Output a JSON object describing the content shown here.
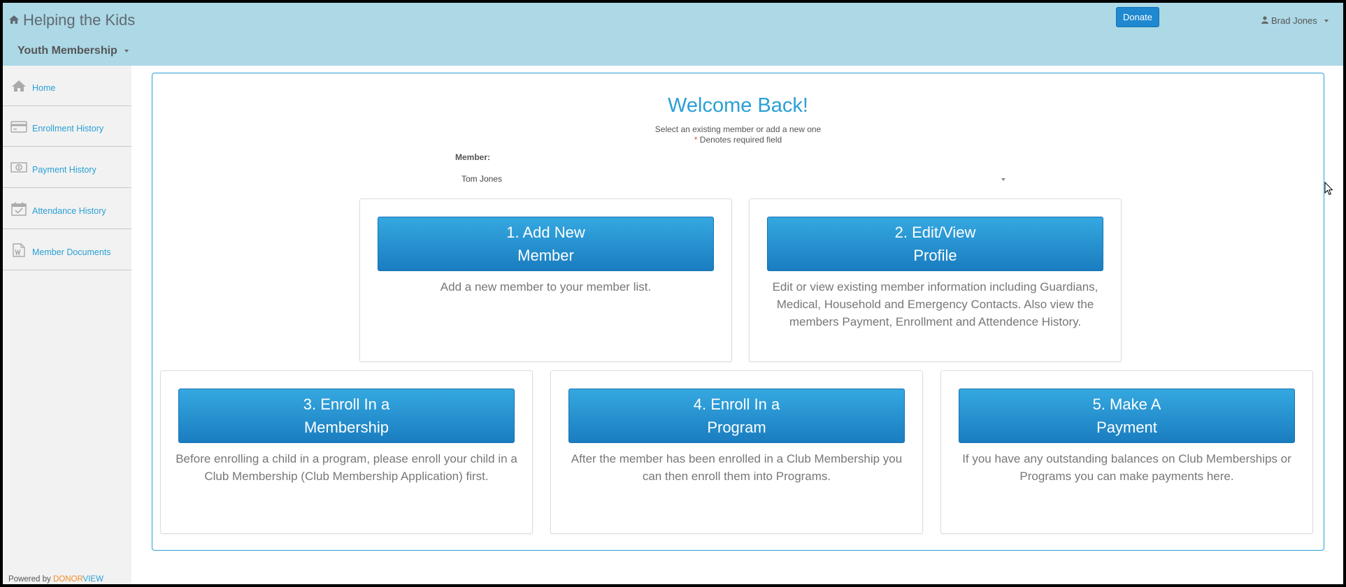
{
  "header": {
    "brand": "Helping the Kids",
    "module": "Youth Membership",
    "donate_label": "Donate",
    "user_name": "Brad Jones"
  },
  "sidebar": {
    "items": [
      {
        "label": "Home",
        "icon": "home-icon"
      },
      {
        "label": "Enrollment History",
        "icon": "credit-card-icon"
      },
      {
        "label": "Payment History",
        "icon": "money-icon"
      },
      {
        "label": "Attendance History",
        "icon": "calendar-check-icon"
      },
      {
        "label": "Member Documents",
        "icon": "document-icon"
      }
    ],
    "powered_prefix": "Powered by ",
    "powered_donor": "DONOR",
    "powered_view": "VIEW"
  },
  "main": {
    "title": "Welcome Back!",
    "subtitle": "Select an existing member or add a new one",
    "required_star": "*",
    "required_note": " Denotes required field",
    "member_label": "Member:",
    "member_value": "Tom Jones",
    "cards": [
      {
        "button_line1": "1. Add New",
        "button_line2": "Member",
        "description": "Add a new member to your member list."
      },
      {
        "button_line1": "2. Edit/View",
        "button_line2": "Profile",
        "description": "Edit or view existing member information including Guardians, Medical, Household and Emergency Contacts. Also view the members Payment, Enrollment and Attendence History."
      },
      {
        "button_line1": "3. Enroll In a",
        "button_line2": "Membership",
        "description": "Before enrolling a child in a program, please enroll your child in a Club Membership (Club Membership Application) first."
      },
      {
        "button_line1": "4. Enroll In a",
        "button_line2": "Program",
        "description": "After the member has been enrolled in a Club Membership you can then enroll them into Programs."
      },
      {
        "button_line1": "5. Make A",
        "button_line2": "Payment",
        "description": "If you have any outstanding balances on Club Memberships or Programs you can make payments here."
      }
    ]
  },
  "colors": {
    "header_bg": "#add8e6",
    "accent": "#2a9fd6",
    "button": "#1e88d0",
    "sidebar_bg": "#f2f2f2"
  }
}
